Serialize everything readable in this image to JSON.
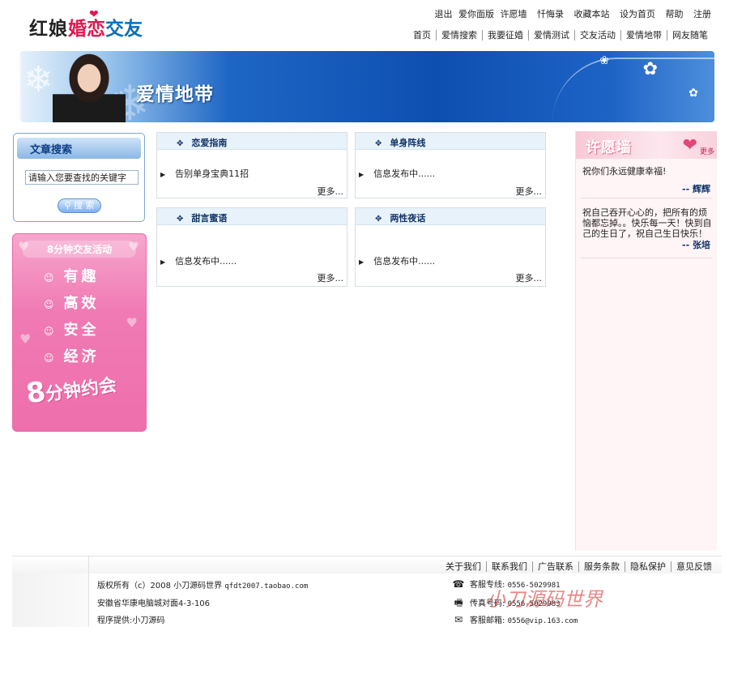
{
  "logo": {
    "part1": "红娘",
    "part2": "婚恋",
    "part3": "交友"
  },
  "top_links": [
    "退出",
    "爱你面版",
    "许愿墙",
    "忏悔录",
    "收藏本站",
    "设为首页",
    "帮助",
    "注册"
  ],
  "main_nav": [
    "首页",
    "爱情搜索",
    "我要征婚",
    "爱情测试",
    "交友活动",
    "爱情地带",
    "网友随笔"
  ],
  "banner": {
    "title": "爱情地带"
  },
  "search": {
    "title": "文章搜索",
    "placeholder": "请输入您要查找的关键字",
    "button": "搜 索"
  },
  "promo": {
    "title": "8分钟交友活动",
    "items": [
      "有趣",
      "高效",
      "安全",
      "经济"
    ],
    "slogan_num": "8",
    "slogan_text": "分钟约会"
  },
  "sections": [
    {
      "title": "恋爱指南",
      "items": [
        "告别单身宝典11招"
      ],
      "more": "更多..."
    },
    {
      "title": "单身阵线",
      "items": [
        "信息发布中......"
      ],
      "more": "更多..."
    },
    {
      "title": "甜言蜜语",
      "items": [
        "信息发布中......"
      ],
      "more": "更多..."
    },
    {
      "title": "两性夜话",
      "items": [
        "信息发布中......"
      ],
      "more": "更多..."
    }
  ],
  "wish_wall": {
    "title": "许愿墙",
    "more": "更多",
    "entries": [
      {
        "text": "祝你们永远健康幸福!",
        "author": "-- 辉辉"
      },
      {
        "text": "祝自己吞开心心的，把所有的烦恼都忘掉。。快乐每一天！快到自己的生日了，祝自己生日快乐！",
        "author": "-- 张培"
      }
    ]
  },
  "footer": {
    "links": [
      "关于我们",
      "联系我们",
      "广告联系",
      "服务条款",
      "隐私保护",
      "意见反馈"
    ],
    "copyright": "版权所有（c）2008 小刀源码世界",
    "site": "qfdt2007.taobao.com",
    "address": "安徽省华康电脑城对面4-3-106",
    "provider": "程序提供:小刀源码",
    "hotline_label": "客服专线:",
    "hotline": "0556-5029981",
    "fax_label": "传真号码:",
    "fax": "0556-5029983",
    "email_label": "客服邮箱:",
    "email": "0556@vip.163.com",
    "watermark": "小刀源码世界"
  }
}
